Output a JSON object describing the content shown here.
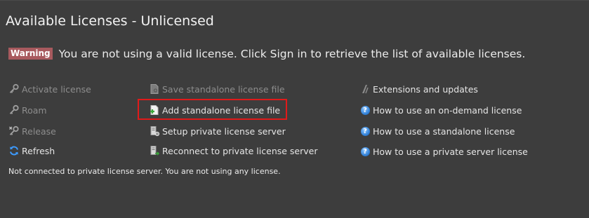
{
  "header": {
    "title": "Available Licenses - Unlicensed"
  },
  "warning": {
    "badge": "Warning",
    "message": "You are not using a valid license. Click Sign in to retrieve the list of available licenses."
  },
  "actions": {
    "col1": [
      {
        "label": "Activate license",
        "icon": "key-icon",
        "enabled": false
      },
      {
        "label": "Roam",
        "icon": "key-roam-icon",
        "enabled": false
      },
      {
        "label": "Release",
        "icon": "key-release-icon",
        "enabled": false
      },
      {
        "label": "Refresh",
        "icon": "refresh-icon",
        "enabled": true
      }
    ],
    "col2": [
      {
        "label": "Save standalone license file",
        "icon": "save-license-icon",
        "enabled": false
      },
      {
        "label": "Add standalone license file",
        "icon": "add-license-icon",
        "enabled": true
      },
      {
        "label": "Setup private license server",
        "icon": "server-setup-icon",
        "enabled": true
      },
      {
        "label": "Reconnect to private license server",
        "icon": "server-reconnect-icon",
        "enabled": true
      }
    ],
    "col3": [
      {
        "label": "Extensions and updates",
        "icon": "extensions-icon",
        "enabled": true
      },
      {
        "label": "How to use an on-demand license",
        "icon": "help-icon",
        "enabled": true
      },
      {
        "label": "How to use a standalone license",
        "icon": "help-icon",
        "enabled": true
      },
      {
        "label": "How to use a private server license",
        "icon": "help-icon",
        "enabled": true
      }
    ]
  },
  "status": {
    "text": "Not connected to private license server. You are not using any license."
  },
  "colors": {
    "background": "#3d3d3d",
    "warning_badge": "#a85a5e",
    "highlight_border": "#e01a1a",
    "help_blue": "#2f7fd6"
  }
}
